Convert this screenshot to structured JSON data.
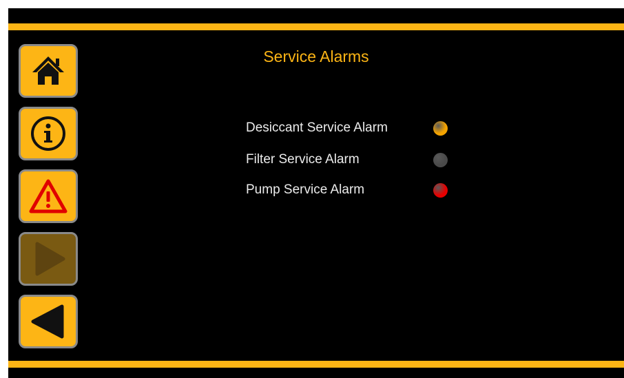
{
  "colors": {
    "accent": "#FDB515",
    "background": "#000000",
    "button_disabled": "#7a5a12",
    "led_amber": "#F4A300",
    "led_gray": "#4a4a4a",
    "led_red": "#E60000"
  },
  "nav": {
    "items": [
      {
        "name": "home",
        "icon": "home-icon",
        "enabled": true
      },
      {
        "name": "info",
        "icon": "info-icon",
        "enabled": true
      },
      {
        "name": "alarms",
        "icon": "warning-icon",
        "enabled": true
      },
      {
        "name": "forward",
        "icon": "play-icon",
        "enabled": false
      },
      {
        "name": "back",
        "icon": "back-arrow-icon",
        "enabled": true
      }
    ]
  },
  "page": {
    "title": "Service Alarms"
  },
  "alarms": [
    {
      "label": "Desiccant Service Alarm",
      "status": "amber",
      "color": "#F4A300"
    },
    {
      "label": "Filter Service Alarm",
      "status": "off",
      "color": "#4a4a4a"
    },
    {
      "label": "Pump Service Alarm",
      "status": "red",
      "color": "#E60000"
    }
  ]
}
